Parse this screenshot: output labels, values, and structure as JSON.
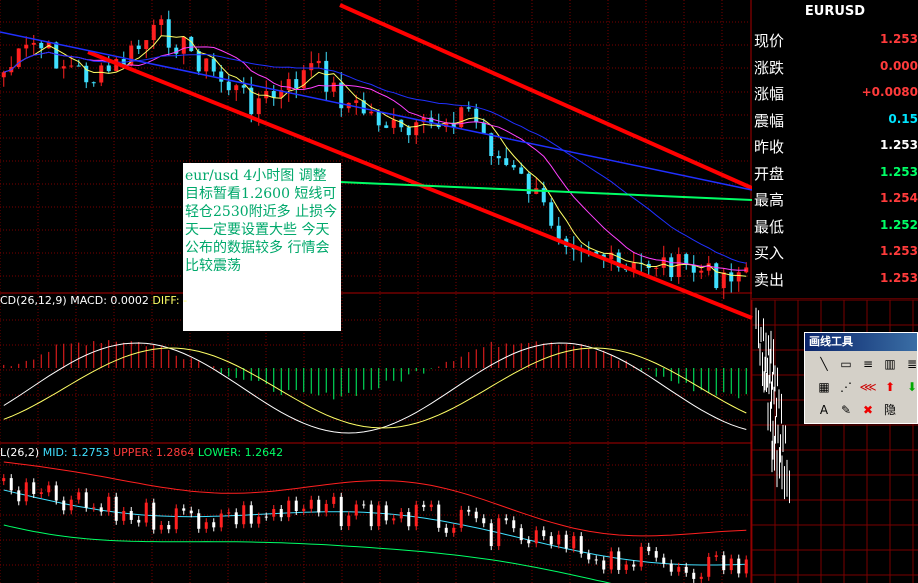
{
  "symbol": "EURUSD",
  "quote_panel": {
    "rows": [
      {
        "label": "现价",
        "value": "1.253",
        "color": "#ff3b3b"
      },
      {
        "label": "涨跌",
        "value": "0.000",
        "color": "#ff3b3b"
      },
      {
        "label": "涨幅",
        "value": "+0.0080",
        "color": "#ff3b3b"
      },
      {
        "label": "震幅",
        "value": "0.15",
        "color": "#00e5ff"
      },
      {
        "label": "昨收",
        "value": "1.253",
        "color": "#ffffff"
      },
      {
        "label": "开盘",
        "value": "1.253",
        "color": "#00ff66"
      },
      {
        "label": "最高",
        "value": "1.254",
        "color": "#ff3b3b"
      },
      {
        "label": "最低",
        "value": "1.252",
        "color": "#00ff66"
      },
      {
        "label": "买入",
        "value": "1.253",
        "color": "#ff3b3b"
      },
      {
        "label": "卖出",
        "value": "1.253",
        "color": "#ff3b3b"
      }
    ]
  },
  "annotation": "eur/usd 4小时图 调整目标暂看1.2600 短线可轻仓2530附近多 止损今天一定要设置大些 今天公布的数据较多 行情会比较震荡",
  "macd_label": {
    "prefix": "CD(26,12,9) MACD: 0.0002",
    "diff": "DIFF: -"
  },
  "boll_label": {
    "prefix": "L(26,2)",
    "mid": "MID: 1.2753",
    "upper": "UPPER: 1.2864",
    "lower": "LOWER: 1.2642"
  },
  "toolbox": {
    "title": "画线工具",
    "tools": [
      "line-tool",
      "rect-tool",
      "hlines-tool",
      "fib-tool",
      "price-tool",
      "channel-tool",
      "gann-tool",
      "fan-tool",
      "up-arrow-tool",
      "down-arrow-tool",
      "text-tool",
      "brush-tool",
      "delete-tool",
      "hide-tool"
    ],
    "tool_glyphs": [
      "╲",
      "▭",
      "≡",
      "▥",
      "≣",
      "▦",
      "⋰",
      "⋘",
      "⬆",
      "⬇",
      "A",
      "✎",
      "✖",
      "隐"
    ],
    "tool_colors": [
      "#000",
      "#000",
      "#000",
      "#000",
      "#000",
      "#000",
      "#000",
      "#c00",
      "#e00",
      "#0a0",
      "#000",
      "#000",
      "#e00",
      "#000"
    ]
  },
  "colors": {
    "grid": "#7a0000",
    "panel_border": "#aa0000",
    "candle_up": "#ff2020",
    "candle_down": "#40e0ff",
    "trend": "#ff0000",
    "support": "#00ff66",
    "ma_slow": "#2030ff",
    "ma_mid": "#ff40ff",
    "ma_fast": "#ffff66",
    "boll_upper": "#ff2020",
    "boll_mid": "#40e0ff",
    "boll_lower": "#00ff66",
    "macd_pos": "#ff2020",
    "macd_neg": "#00ff66"
  },
  "chart_data": {
    "type": "line",
    "title": "EURUSD",
    "candles_trend": [
      1.28,
      1.284,
      1.281,
      1.279,
      1.282,
      1.286,
      1.283,
      1.279,
      1.276,
      1.277,
      1.281,
      1.276,
      1.274,
      1.271,
      1.273,
      1.275,
      1.268,
      1.264,
      1.258,
      1.256,
      1.252,
      1.254,
      1.253,
      1.252,
      1.253
    ],
    "boll": {
      "mid": 1.2753,
      "upper": 1.2864,
      "lower": 1.2642
    },
    "macd": 0.0002
  }
}
